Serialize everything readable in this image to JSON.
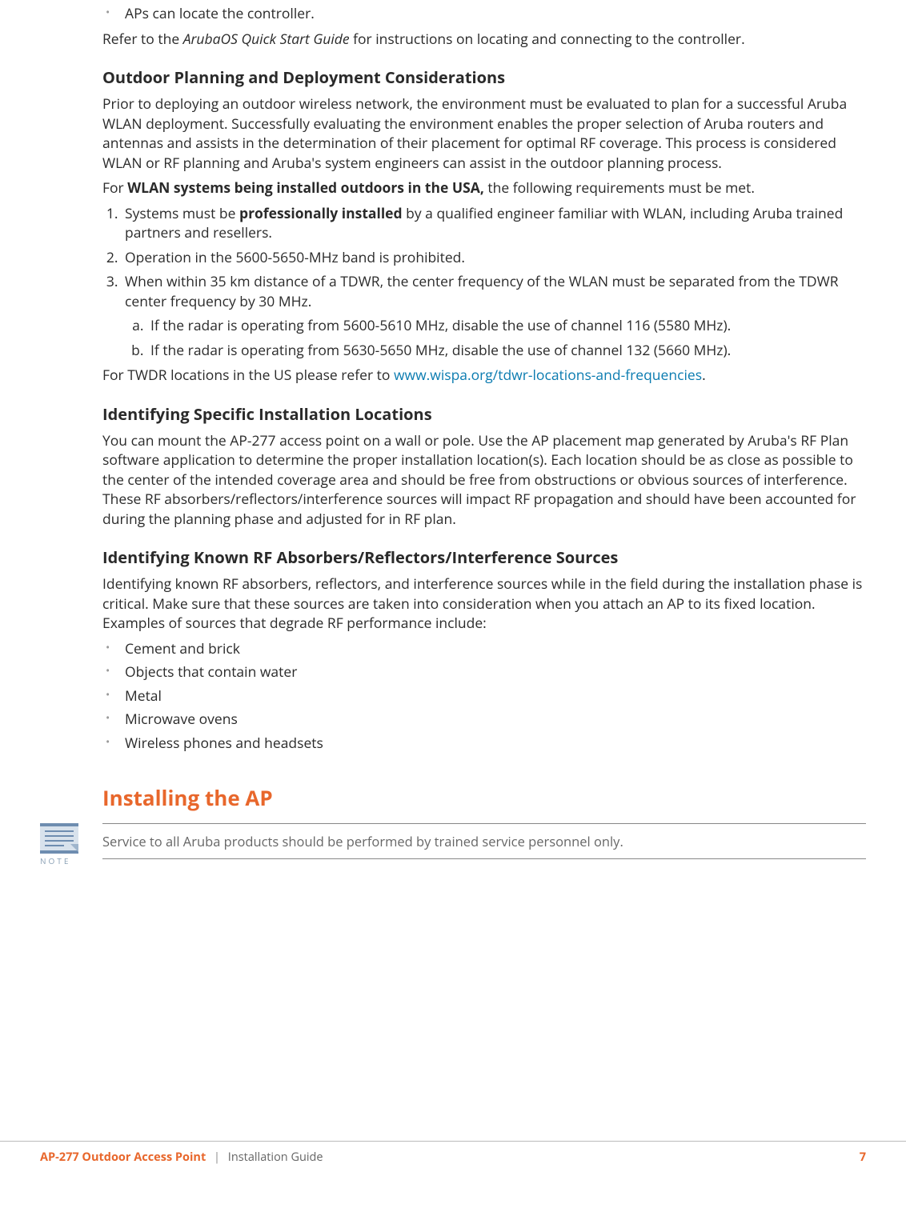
{
  "top": {
    "bullet1": "APs can locate the controller.",
    "refer_pre": "Refer to the ",
    "refer_italic": "ArubaOS Quick Start Guide",
    "refer_post": " for instructions on locating and connecting to the controller."
  },
  "sec_outdoor": {
    "heading": "Outdoor Planning and Deployment Considerations",
    "para": "Prior to deploying an outdoor wireless network, the environment must be evaluated to plan for a successful Aruba WLAN deployment. Successfully evaluating the environment enables the proper selection of Aruba routers and antennas and assists in the determination of their placement for optimal RF coverage. This process is considered WLAN or RF planning and Aruba's system engineers can assist in the outdoor planning process.",
    "for_pre": "For ",
    "for_bold": "WLAN systems being installed outdoors in the USA,",
    "for_post": " the following requirements must be met.",
    "li1_pre": "Systems must be ",
    "li1_bold": "professionally installed",
    "li1_post": " by a qualified engineer familiar with WLAN, including Aruba trained partners and resellers.",
    "li2": "Operation in the 5600-5650-MHz band is prohibited.",
    "li3": "When within 35 km distance of a TDWR, the center frequency of the WLAN must be separated from the TDWR center frequency by 30 MHz.",
    "li3a": "If the radar is operating from 5600-5610 MHz, disable the use of channel 116 (5580 MHz).",
    "li3b": "If the radar is operating from 5630-5650 MHz, disable the use of channel 132 (5660 MHz).",
    "twdr_pre": "For TWDR locations in the US please refer to ",
    "twdr_link": "www.wispa.org/tdwr-locations-and-frequencies",
    "twdr_post": "."
  },
  "sec_locations": {
    "heading": "Identifying Specific Installation Locations",
    "para": "You can mount the AP-277 access point on a wall or pole. Use the AP placement map generated by Aruba's RF Plan software application to determine the proper installation location(s). Each location should be as close as possible to the center of the intended coverage area and should be free from obstructions or obvious sources of interference. These RF absorbers/reflectors/interference sources will impact RF propagation and should have been accounted for during the planning phase and adjusted for in RF plan."
  },
  "sec_rf": {
    "heading": "Identifying Known RF Absorbers/Reflectors/Interference Sources",
    "para": "Identifying known RF absorbers, reflectors, and interference sources while in the field during the installation phase is critical. Make sure that these sources are taken into consideration when you attach an AP to its fixed location. Examples of sources that degrade RF performance include:",
    "items": [
      "Cement and brick",
      "Objects that contain water",
      "Metal",
      "Microwave ovens",
      "Wireless phones and headsets"
    ]
  },
  "install": {
    "heading": "Installing the AP",
    "note_label": "NOTE",
    "note_text": "Service to all Aruba products should be performed by trained service personnel only."
  },
  "footer": {
    "product": "AP-277 Outdoor Access Point",
    "sep": "|",
    "doc": "Installation Guide",
    "page": "7"
  }
}
